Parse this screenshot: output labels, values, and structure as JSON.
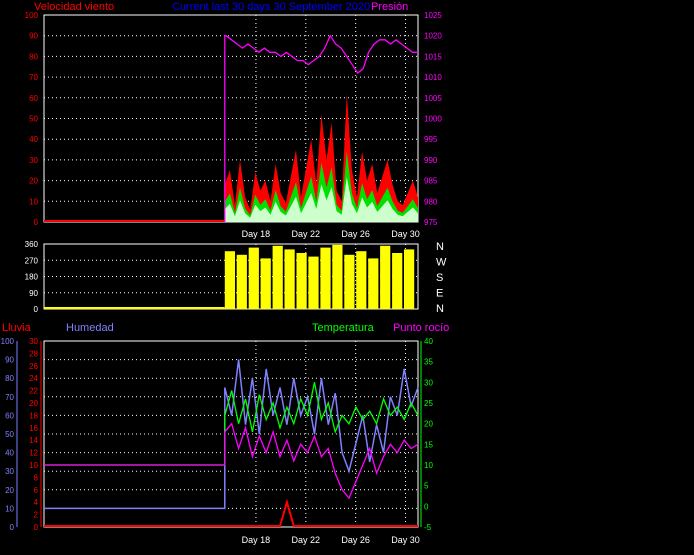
{
  "colors": {
    "background": "#000000",
    "wind": "#ff0000",
    "wind_gust": "#00e000",
    "wind_light": "#ccffcc",
    "pressure": "#ff00ff",
    "direction": "#ffff00",
    "rain": "#ff0000",
    "humidity": "#8080ff",
    "temperature": "#00ff00",
    "dewpoint": "#ff00ff",
    "title": "#0000ff",
    "axis_text_left": "#ff0000",
    "axis_text_right": "#ff00ff",
    "axis_text_white": "#ffffff"
  },
  "header": {
    "wind_label": "Velocidad viento",
    "title": "Current last 30 days 30 September 2020",
    "pressure_label": "Presión"
  },
  "lower_header": {
    "rain_label": "Lluvia",
    "humidity_label": "Humedad",
    "temperature_label": "Temperatura",
    "dewpoint_label": "Punto rocío"
  },
  "compass_labels": [
    "N",
    "W",
    "S",
    "E",
    "N"
  ],
  "chart_data": [
    {
      "type": "area",
      "title": "Current last 30 days 30 September 2020",
      "x_ticks": [
        "Day 18",
        "Day 22",
        "Day 26",
        "Day 30"
      ],
      "x_tick_days": [
        18,
        22,
        26,
        30
      ],
      "x_range": [
        1,
        31
      ],
      "data_start_day": 15.5,
      "y_left": {
        "label": "Velocidad viento",
        "ticks": [
          0,
          10,
          20,
          30,
          40,
          50,
          60,
          70,
          80,
          90,
          100
        ],
        "range": [
          0,
          100
        ]
      },
      "y_right": {
        "label": "Presión",
        "ticks": [
          975,
          980,
          985,
          990,
          995,
          1000,
          1005,
          1010,
          1015,
          1020,
          1025
        ],
        "range": [
          975,
          1025
        ]
      },
      "series": [
        {
          "name": "Velocidad viento",
          "values": [
            0,
            0,
            18,
            25,
            8,
            30,
            12,
            6,
            24,
            15,
            20,
            10,
            28,
            14,
            9,
            22,
            35,
            12,
            26,
            40,
            18,
            52,
            30,
            48,
            15,
            10,
            62,
            25,
            12,
            34,
            20,
            28,
            14,
            22,
            30,
            18,
            10,
            8,
            14,
            20,
            12
          ]
        },
        {
          "name": "Presión",
          "values": [
            1020,
            1019,
            1018,
            1017,
            1018,
            1017,
            1016,
            1017,
            1016,
            1016,
            1015,
            1016,
            1015,
            1014,
            1014,
            1013,
            1014,
            1015,
            1017,
            1020,
            1018,
            1017,
            1015,
            1013,
            1011,
            1012,
            1016,
            1018,
            1019,
            1019,
            1018,
            1019,
            1018,
            1017,
            1016,
            1016
          ]
        }
      ]
    },
    {
      "type": "bar",
      "y_ticks": [
        0,
        90,
        180,
        270,
        360
      ],
      "y_range": [
        0,
        360
      ],
      "series": [
        {
          "name": "Dirección",
          "values": [
            320,
            300,
            340,
            280,
            350,
            330,
            310,
            290,
            340,
            355,
            300,
            320,
            280,
            350,
            310,
            330
          ]
        }
      ]
    },
    {
      "type": "line",
      "y_left_humidity": {
        "label": "Humedad",
        "ticks": [
          0,
          10,
          20,
          30,
          40,
          50,
          60,
          70,
          80,
          90,
          100
        ],
        "range": [
          0,
          100
        ]
      },
      "y_left_rain": {
        "label": "Lluvia",
        "ticks": [
          0,
          2,
          4,
          6,
          8,
          10,
          12,
          14,
          16,
          18,
          20,
          22,
          24,
          26,
          28,
          30
        ],
        "range": [
          0,
          30
        ]
      },
      "y_right": {
        "label": "Temperatura / Punto rocío",
        "ticks": [
          -5,
          0,
          5,
          10,
          15,
          20,
          25,
          30,
          35,
          40
        ],
        "range": [
          -5,
          40
        ]
      },
      "series": [
        {
          "name": "Humedad",
          "values": [
            10,
            10,
            75,
            60,
            90,
            55,
            80,
            50,
            85,
            60,
            75,
            55,
            80,
            60,
            70,
            50,
            80,
            55,
            72,
            40,
            30,
            45,
            60,
            35,
            55,
            40,
            70,
            60,
            85,
            65,
            75
          ]
        },
        {
          "name": "Temperatura",
          "values": [
            10,
            10,
            22,
            28,
            20,
            26,
            18,
            27,
            21,
            25,
            19,
            24,
            20,
            26,
            22,
            30,
            21,
            25,
            18,
            22,
            20,
            24,
            21,
            23,
            20,
            26,
            22,
            24,
            21,
            25,
            22
          ]
        },
        {
          "name": "Punto rocío",
          "values": [
            10,
            10,
            18,
            20,
            14,
            19,
            12,
            17,
            13,
            18,
            12,
            16,
            11,
            15,
            13,
            17,
            12,
            14,
            8,
            4,
            2,
            6,
            10,
            14,
            8,
            12,
            15,
            13,
            16,
            14,
            15
          ]
        },
        {
          "name": "Lluvia",
          "values": [
            0,
            0,
            0,
            0,
            0,
            0,
            0,
            0,
            0,
            0,
            0,
            4,
            0,
            0,
            0,
            0,
            0,
            0,
            0,
            0,
            0,
            0,
            0,
            0,
            0,
            0,
            0,
            0,
            0,
            0,
            0
          ]
        }
      ]
    }
  ]
}
